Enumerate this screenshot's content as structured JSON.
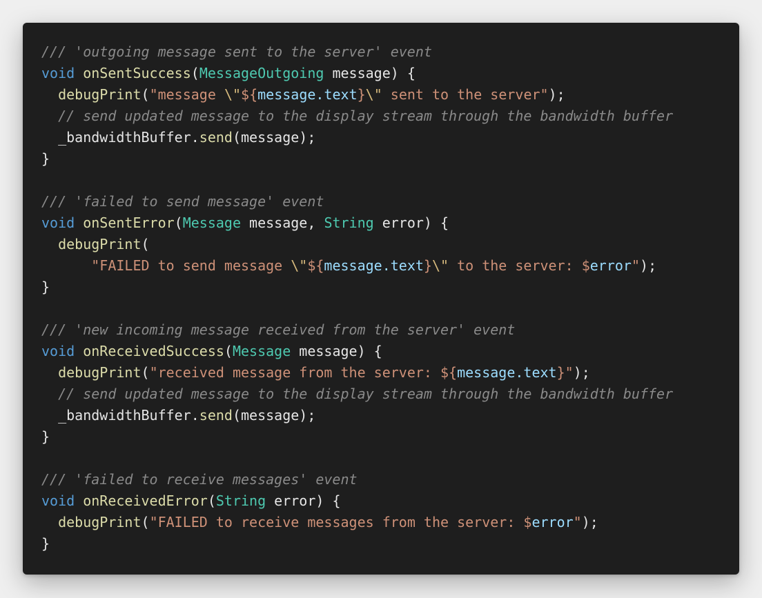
{
  "colors": {
    "background": "#efefef",
    "editor_background": "#1e1e1e",
    "comment": "#8a8a8a",
    "keyword": "#569cd6",
    "function": "#dcdcaa",
    "type": "#4ec9b0",
    "string": "#ce9178",
    "escape": "#d7ba7d",
    "variable": "#9cdcfe",
    "plain": "#e6e6e6"
  },
  "code_lines": [
    [
      {
        "t": "comment",
        "v": "/// 'outgoing message sent to the server' event"
      }
    ],
    [
      {
        "t": "keyword",
        "v": "void"
      },
      {
        "t": "plain",
        "v": " "
      },
      {
        "t": "function",
        "v": "onSentSuccess"
      },
      {
        "t": "plain",
        "v": "("
      },
      {
        "t": "type",
        "v": "MessageOutgoing"
      },
      {
        "t": "plain",
        "v": " message) {"
      }
    ],
    [
      {
        "t": "plain",
        "v": "  "
      },
      {
        "t": "function",
        "v": "debugPrint"
      },
      {
        "t": "plain",
        "v": "("
      },
      {
        "t": "string",
        "v": "\"message "
      },
      {
        "t": "escape",
        "v": "\\\""
      },
      {
        "t": "string",
        "v": "${"
      },
      {
        "t": "variable",
        "v": "message.text"
      },
      {
        "t": "string",
        "v": "}"
      },
      {
        "t": "escape",
        "v": "\\\""
      },
      {
        "t": "string",
        "v": " sent to the server\""
      },
      {
        "t": "plain",
        "v": ");"
      }
    ],
    [
      {
        "t": "plain",
        "v": "  "
      },
      {
        "t": "comment",
        "v": "// send updated message to the display stream through the bandwidth buffer"
      }
    ],
    [
      {
        "t": "plain",
        "v": "  _bandwidthBuffer."
      },
      {
        "t": "function",
        "v": "send"
      },
      {
        "t": "plain",
        "v": "(message);"
      }
    ],
    [
      {
        "t": "plain",
        "v": "}"
      }
    ],
    [],
    [
      {
        "t": "comment",
        "v": "/// 'failed to send message' event"
      }
    ],
    [
      {
        "t": "keyword",
        "v": "void"
      },
      {
        "t": "plain",
        "v": " "
      },
      {
        "t": "function",
        "v": "onSentError"
      },
      {
        "t": "plain",
        "v": "("
      },
      {
        "t": "type",
        "v": "Message"
      },
      {
        "t": "plain",
        "v": " message, "
      },
      {
        "t": "type",
        "v": "String"
      },
      {
        "t": "plain",
        "v": " error) {"
      }
    ],
    [
      {
        "t": "plain",
        "v": "  "
      },
      {
        "t": "function",
        "v": "debugPrint"
      },
      {
        "t": "plain",
        "v": "("
      }
    ],
    [
      {
        "t": "plain",
        "v": "      "
      },
      {
        "t": "string",
        "v": "\"FAILED to send message "
      },
      {
        "t": "escape",
        "v": "\\\""
      },
      {
        "t": "string",
        "v": "${"
      },
      {
        "t": "variable",
        "v": "message.text"
      },
      {
        "t": "string",
        "v": "}"
      },
      {
        "t": "escape",
        "v": "\\\""
      },
      {
        "t": "string",
        "v": " to the server: $"
      },
      {
        "t": "variable",
        "v": "error"
      },
      {
        "t": "string",
        "v": "\""
      },
      {
        "t": "plain",
        "v": ");"
      }
    ],
    [
      {
        "t": "plain",
        "v": "}"
      }
    ],
    [],
    [
      {
        "t": "comment",
        "v": "/// 'new incoming message received from the server' event"
      }
    ],
    [
      {
        "t": "keyword",
        "v": "void"
      },
      {
        "t": "plain",
        "v": " "
      },
      {
        "t": "function",
        "v": "onReceivedSuccess"
      },
      {
        "t": "plain",
        "v": "("
      },
      {
        "t": "type",
        "v": "Message"
      },
      {
        "t": "plain",
        "v": " message) {"
      }
    ],
    [
      {
        "t": "plain",
        "v": "  "
      },
      {
        "t": "function",
        "v": "debugPrint"
      },
      {
        "t": "plain",
        "v": "("
      },
      {
        "t": "string",
        "v": "\"received message from the server: ${"
      },
      {
        "t": "variable",
        "v": "message.text"
      },
      {
        "t": "string",
        "v": "}\""
      },
      {
        "t": "plain",
        "v": ");"
      }
    ],
    [
      {
        "t": "plain",
        "v": "  "
      },
      {
        "t": "comment",
        "v": "// send updated message to the display stream through the bandwidth buffer"
      }
    ],
    [
      {
        "t": "plain",
        "v": "  _bandwidthBuffer."
      },
      {
        "t": "function",
        "v": "send"
      },
      {
        "t": "plain",
        "v": "(message);"
      }
    ],
    [
      {
        "t": "plain",
        "v": "}"
      }
    ],
    [],
    [
      {
        "t": "comment",
        "v": "/// 'failed to receive messages' event"
      }
    ],
    [
      {
        "t": "keyword",
        "v": "void"
      },
      {
        "t": "plain",
        "v": " "
      },
      {
        "t": "function",
        "v": "onReceivedError"
      },
      {
        "t": "plain",
        "v": "("
      },
      {
        "t": "type",
        "v": "String"
      },
      {
        "t": "plain",
        "v": " error) {"
      }
    ],
    [
      {
        "t": "plain",
        "v": "  "
      },
      {
        "t": "function",
        "v": "debugPrint"
      },
      {
        "t": "plain",
        "v": "("
      },
      {
        "t": "string",
        "v": "\"FAILED to receive messages from the server: $"
      },
      {
        "t": "variable",
        "v": "error"
      },
      {
        "t": "string",
        "v": "\""
      },
      {
        "t": "plain",
        "v": ");"
      }
    ],
    [
      {
        "t": "plain",
        "v": "}"
      }
    ]
  ]
}
